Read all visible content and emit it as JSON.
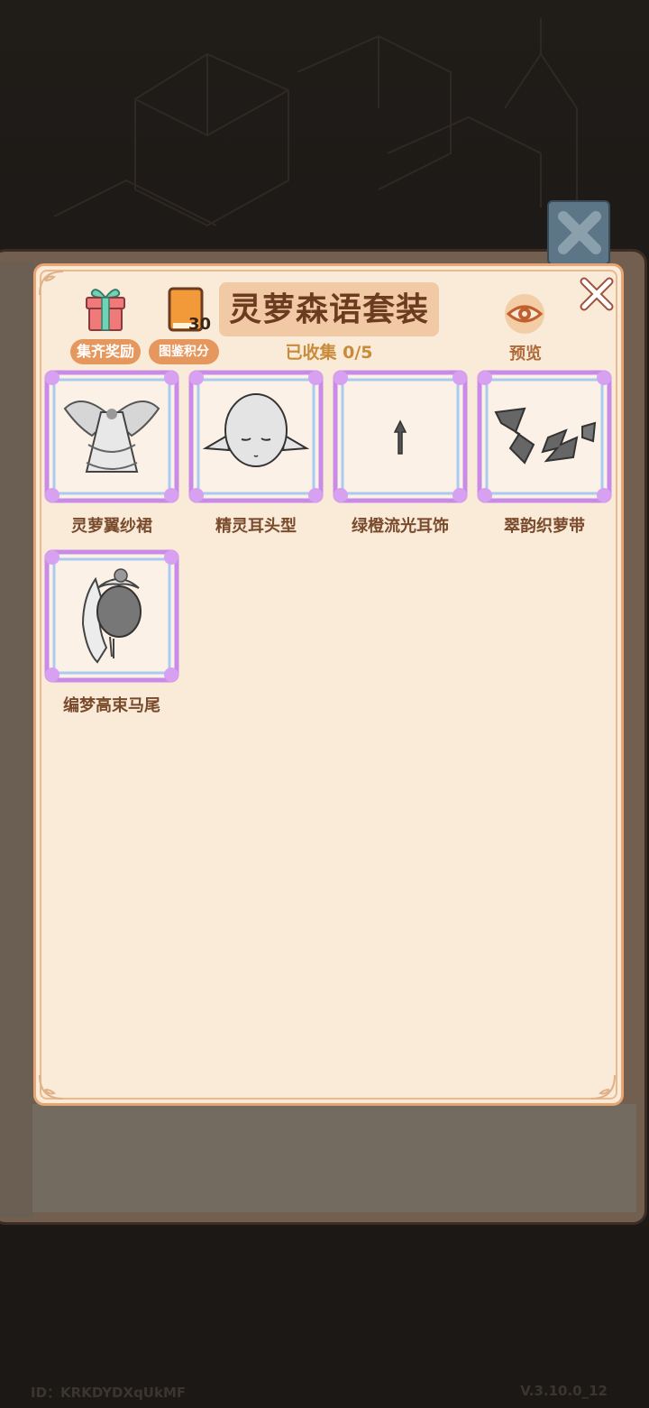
{
  "suit_title": "灵萝森语套装",
  "collected_text": "已收集 0/5",
  "buttons": {
    "reward_label": "集齐奖励",
    "score_label": "图鉴积分",
    "score_value": "30",
    "preview_label": "预览"
  },
  "items": [
    {
      "name": "灵萝翼纱裙",
      "icon": "dress-icon"
    },
    {
      "name": "精灵耳头型",
      "icon": "elf-head-icon"
    },
    {
      "name": "绿橙流光耳饰",
      "icon": "earring-icon"
    },
    {
      "name": "翠韵织萝带",
      "icon": "ribbon-icon"
    },
    {
      "name": "编梦高束马尾",
      "icon": "ponytail-icon"
    }
  ],
  "footer": {
    "id_text": "ID：KRKDYDXqUkMF",
    "version": "V.3.10.0_12"
  },
  "colors": {
    "panel_bg": "#faebd9",
    "title_text": "#6b3c20",
    "accent_orange": "#e6975e",
    "frame_purple": "#c98be8"
  }
}
